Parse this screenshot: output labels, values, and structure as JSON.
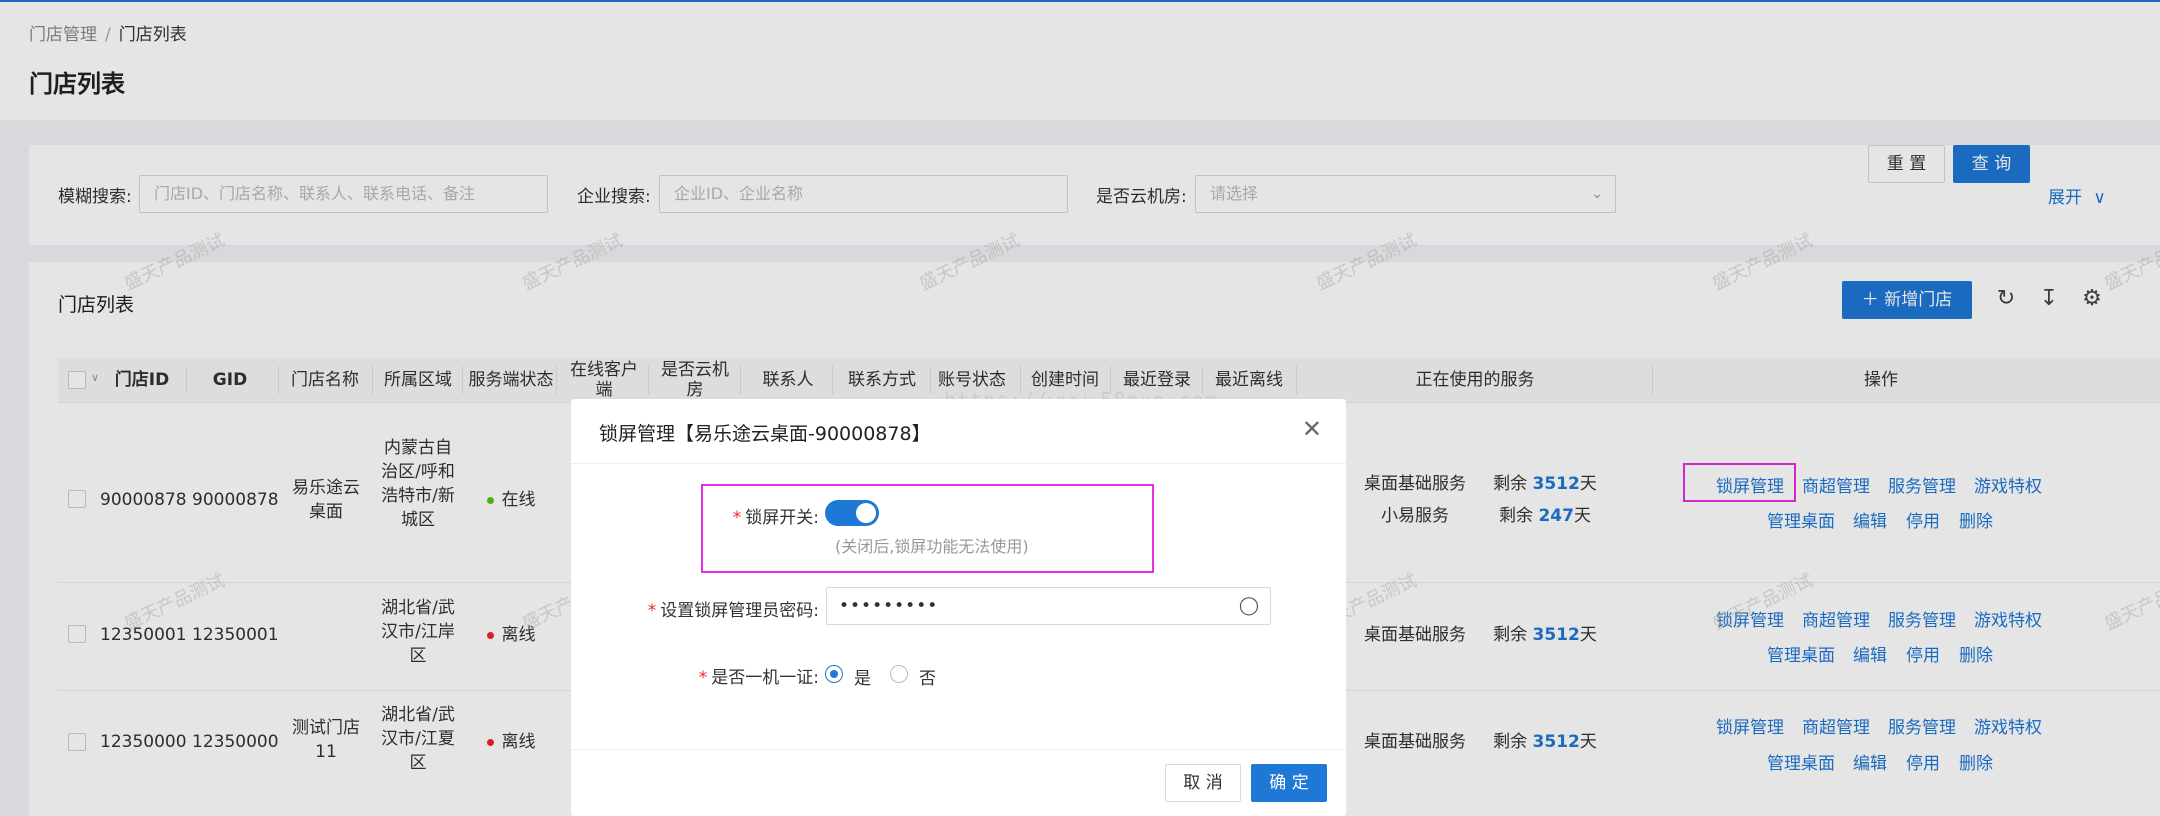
{
  "breadcrumb": {
    "parent": "门店管理",
    "separator": "/",
    "current": "门店列表"
  },
  "page_title": "门店列表",
  "search": {
    "fuzzy_label": "模糊搜索:",
    "fuzzy_placeholder": "门店ID、门店名称、联系人、联系电话、备注",
    "company_label": "企业搜索:",
    "company_placeholder": "企业ID、企业名称",
    "cloud_label": "是否云机房:",
    "cloud_placeholder": "请选择",
    "reset_label": "重 置",
    "query_label": "查 询",
    "expand_label": "展开"
  },
  "list": {
    "title": "门店列表",
    "add_label": "新增门店",
    "columns": {
      "store_id": "门店ID",
      "gid": "GID",
      "name": "门店名称",
      "region": "所属区域",
      "server_status": "服务端状态",
      "online_client": "在线客户端",
      "cloud_room": "是否云机房",
      "contact": "联系人",
      "contact_method": "联系方式",
      "account_status": "账号状态",
      "created": "创建时间",
      "last_login": "最近登录",
      "last_offline": "最近离线",
      "services": "正在使用的服务",
      "actions": "操作"
    },
    "rows": [
      {
        "store_id": "90000878",
        "gid": "90000878",
        "name": "易乐途云桌面",
        "region": "内蒙古自治区/呼和浩特市/新城区",
        "status": "在线",
        "services": [
          {
            "name": "桌面基础服务",
            "remain_prefix": "剩余",
            "days": "3512",
            "unit": "天"
          },
          {
            "name": "小易服务",
            "remain_prefix": "剩余",
            "days": "247",
            "unit": "天"
          }
        ]
      },
      {
        "store_id": "12350001",
        "gid": "12350001",
        "name": "",
        "region": "湖北省/武汉市/江岸区",
        "status": "离线",
        "services": [
          {
            "name": "桌面基础服务",
            "remain_prefix": "剩余",
            "days": "3512",
            "unit": "天"
          }
        ]
      },
      {
        "store_id": "12350000",
        "gid": "12350000",
        "name": "测试门店11",
        "region": "湖北省/武汉市/江夏区",
        "status": "离线",
        "services": [
          {
            "name": "桌面基础服务",
            "remain_prefix": "剩余",
            "days": "3512",
            "unit": "天"
          }
        ]
      }
    ],
    "actions": [
      "锁屏管理",
      "商超管理",
      "服务管理",
      "游戏特权",
      "管理桌面",
      "编辑",
      "停用",
      "删除"
    ]
  },
  "watermark_text": "盛天产品测试",
  "site_watermark": "https://www.58pxe.com",
  "modal": {
    "title": "锁屏管理【易乐途云桌面-90000878】",
    "required_mark": "*",
    "lock_switch_label": "锁屏开关:",
    "lock_switch_on": true,
    "lock_hint": "(关闭后,锁屏功能无法使用)",
    "password_label": "设置锁屏管理员密码:",
    "password_value": "•••••••••",
    "one_cert_label": "是否一机一证:",
    "option_yes": "是",
    "option_no": "否",
    "selected": "是",
    "cancel_label": "取 消",
    "confirm_label": "确 定"
  },
  "colors": {
    "primary": "#1d78d6",
    "online": "#52c41a",
    "offline": "#f5222d",
    "highlight": "#e62ee6"
  }
}
